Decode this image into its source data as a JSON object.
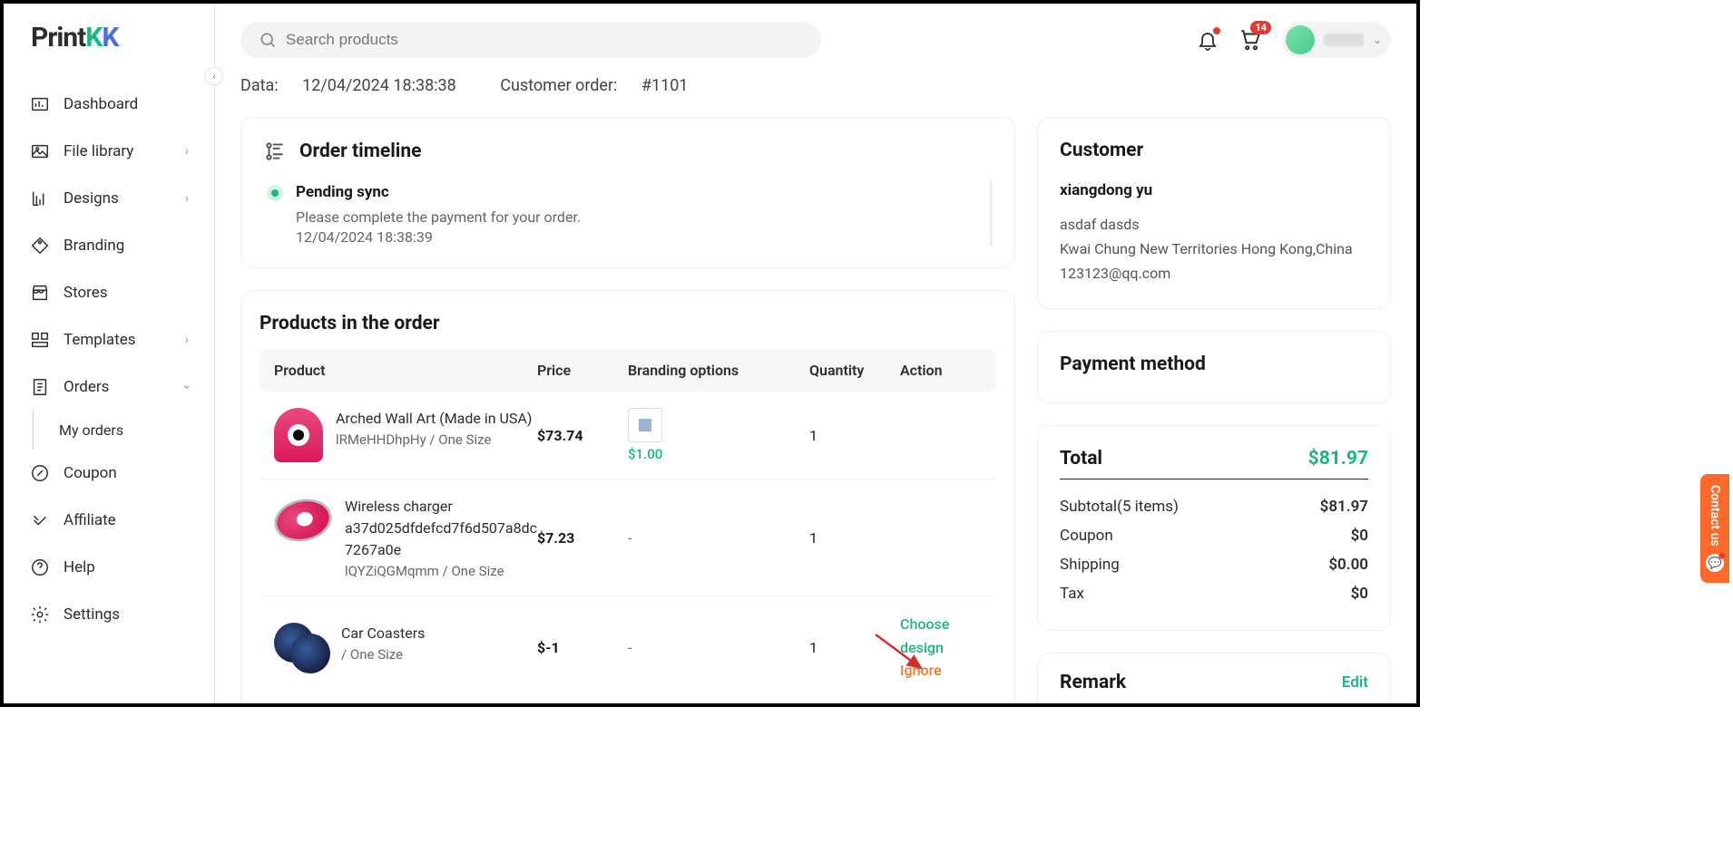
{
  "brand": {
    "p1": "Print",
    "p2": "K",
    "p3": "K"
  },
  "search": {
    "placeholder": "Search products"
  },
  "topbar": {
    "cart_badge": "14"
  },
  "nav": {
    "dashboard": "Dashboard",
    "file_library": "File library",
    "designs": "Designs",
    "branding": "Branding",
    "stores": "Stores",
    "templates": "Templates",
    "orders": "Orders",
    "my_orders": "My orders",
    "coupon": "Coupon",
    "affiliate": "Affiliate",
    "help": "Help",
    "settings": "Settings"
  },
  "meta": {
    "data_label": "Data: ",
    "data_value": "12/04/2024 18:38:38",
    "order_label": "Customer order: ",
    "order_value": "#1101"
  },
  "timeline": {
    "title": "Order timeline",
    "status": "Pending sync",
    "desc": "Please complete the payment for your order.",
    "time": "12/04/2024 18:38:39"
  },
  "products": {
    "title": "Products in the order",
    "cols": {
      "product": "Product",
      "price": "Price",
      "branding": "Branding options",
      "qty": "Quantity",
      "action": "Action"
    },
    "rows": [
      {
        "name": "Arched Wall Art (Made in USA)",
        "variant": "lRMeHHDhpHy / One Size",
        "price": "$73.74",
        "branding_price": "$1.00",
        "has_branding": true,
        "qty": "1",
        "actions": []
      },
      {
        "name": "Wireless charger a37d025dfdefcd7f6d507a8dc7267a0e",
        "variant": "lQYZiQGMqmm / One Size",
        "price": "$7.23",
        "branding_dash": "-",
        "has_branding": false,
        "qty": "1",
        "actions": []
      },
      {
        "name": "Car Coasters",
        "variant": "/ One Size",
        "price": "$-1",
        "branding_dash": "-",
        "has_branding": false,
        "qty": "1",
        "actions": [
          "Choose design",
          "Ignore"
        ]
      }
    ]
  },
  "customer": {
    "title": "Customer",
    "name": "xiangdong yu",
    "line1": "asdaf   dasds",
    "line2": "Kwai Chung   New Territories   Hong Kong,China",
    "email": "123123@qq.com"
  },
  "payment": {
    "title": "Payment method"
  },
  "total": {
    "title": "Total",
    "amount": "$81.97",
    "subtotal_label": "Subtotal(5 items)",
    "subtotal": "$81.97",
    "coupon_label": "Coupon",
    "coupon": "$0",
    "shipping_label": "Shipping",
    "shipping": "$0.00",
    "tax_label": "Tax",
    "tax": "$0"
  },
  "remark": {
    "title": "Remark",
    "edit": "Edit"
  },
  "contact": {
    "label": "Contact us"
  }
}
